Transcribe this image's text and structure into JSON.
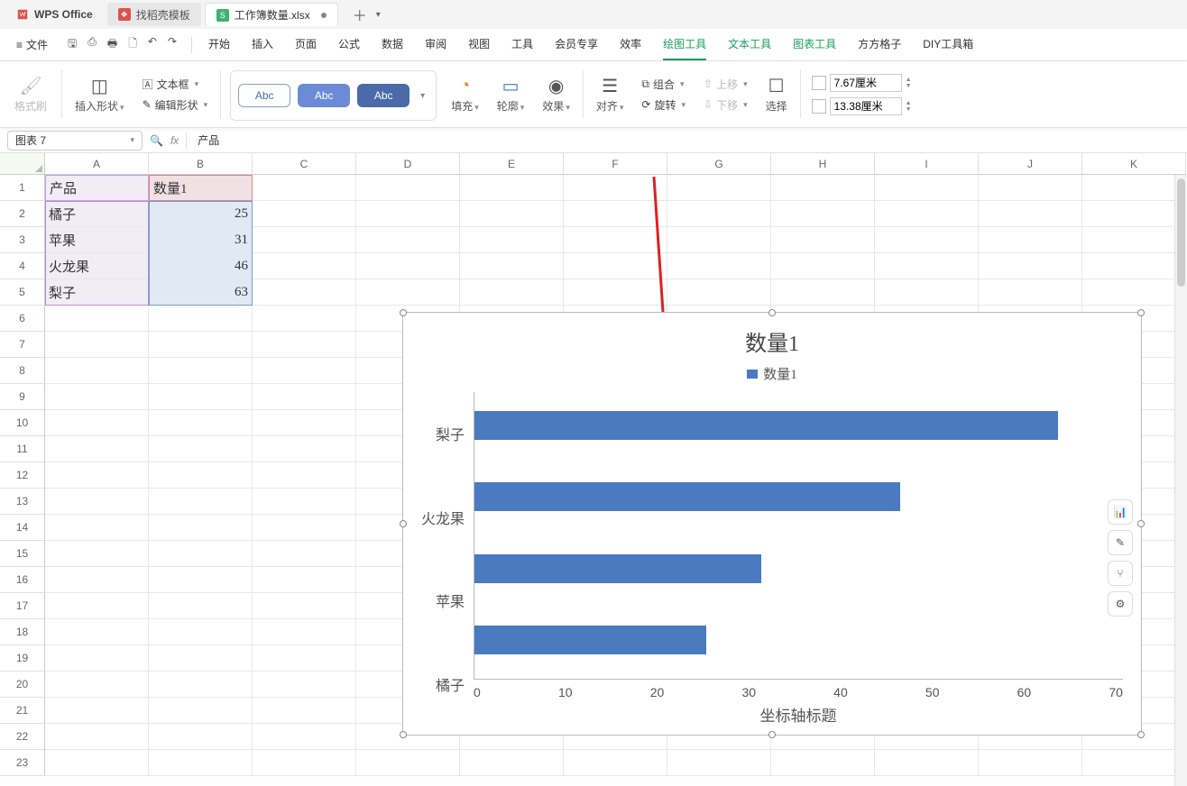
{
  "app": {
    "name": "WPS Office"
  },
  "doc_tabs": [
    {
      "label": "找稻壳模板",
      "active": false
    },
    {
      "label": "工作簿数量.xlsx",
      "active": true
    }
  ],
  "menu": {
    "file": "文件",
    "tabs": [
      "开始",
      "插入",
      "页面",
      "公式",
      "数据",
      "审阅",
      "视图",
      "工具",
      "会员专享",
      "效率"
    ],
    "tabs_green": [
      "绘图工具",
      "文本工具",
      "图表工具"
    ],
    "tabs_tail": [
      "方方格子",
      "DIY工具箱"
    ],
    "active_green": "绘图工具"
  },
  "ribbon": {
    "format_painter": "格式刷",
    "insert_shape": "插入形状",
    "text_box": "文本框",
    "edit_shape": "编辑形状",
    "preset_label": "Abc",
    "fill": "填充",
    "outline": "轮廓",
    "effects": "效果",
    "align": "对齐",
    "group": "组合",
    "rotate": "旋转",
    "move_up": "上移",
    "move_down": "下移",
    "select": "选择",
    "width_value": "7.67厘米",
    "height_value": "13.38厘米"
  },
  "formula_bar": {
    "namebox": "图表 7",
    "content": "产品"
  },
  "grid": {
    "columns": [
      "A",
      "B",
      "C",
      "D",
      "E",
      "F",
      "G",
      "H",
      "I",
      "J",
      "K"
    ],
    "rows": 23,
    "data": {
      "A1": "产品",
      "B1": "数量1",
      "A2": "橘子",
      "B2": "25",
      "A3": "苹果",
      "B3": "31",
      "A4": "火龙果",
      "B4": "46",
      "A5": "梨子",
      "B5": "63"
    }
  },
  "chart_data": {
    "type": "bar",
    "orientation": "horizontal",
    "title": "数量1",
    "legend": [
      "数量1"
    ],
    "categories": [
      "梨子",
      "火龙果",
      "苹果",
      "橘子"
    ],
    "values": [
      63,
      46,
      31,
      25
    ],
    "xlabel": "坐标轴标题",
    "xticks": [
      0,
      10,
      20,
      30,
      40,
      50,
      60,
      70
    ],
    "xlim": [
      0,
      70
    ],
    "series_color": "#4a7ac0"
  },
  "chart_side_buttons": [
    "chart-elements-icon",
    "edit-icon",
    "filter-icon",
    "settings-icon"
  ]
}
